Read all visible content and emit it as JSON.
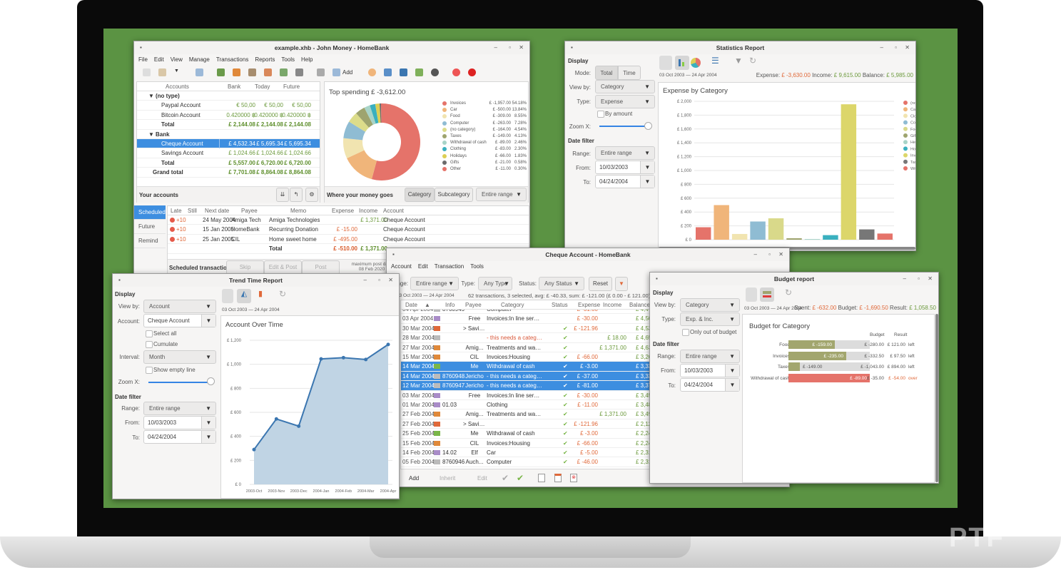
{
  "colors": {
    "accent": "#3d8ee0",
    "desktop": "#5b9343",
    "income": "#6c9a3d",
    "expense": "#e0693a"
  },
  "main": {
    "title": "example.xhb - John Money - HomeBank",
    "menu": [
      "File",
      "Edit",
      "View",
      "Manage",
      "Transactions",
      "Reports",
      "Tools",
      "Help"
    ],
    "toolbar": {
      "icons": [
        "new-file-icon",
        "open-file-icon",
        "dropdown-icon",
        "save-icon",
        "accounts-icon",
        "payees-icon",
        "categories-icon",
        "budget-icon",
        "archive-icon",
        "assistant-icon",
        "show-account-icon",
        "add-transaction-icon",
        "statistics-icon",
        "trend-icon",
        "balance-icon",
        "budget-report-icon",
        "vehicle-cost-icon",
        "help-icon",
        "donate-icon"
      ],
      "add_label": "Add"
    },
    "accounts": {
      "headers": [
        "Accounts",
        "Bank",
        "Today",
        "Future"
      ],
      "rows": [
        {
          "kind": "group",
          "name": "(no type)"
        },
        {
          "kind": "item",
          "name": "Paypal Account",
          "bank": "€ 50,00",
          "today": "€ 50,00",
          "future": "€ 50,00"
        },
        {
          "kind": "item",
          "name": "Bitcoin Account",
          "bank": "0.420000 ฿",
          "today": "0.420000 ฿",
          "future": "0.420000 ฿"
        },
        {
          "kind": "total",
          "name": "Total",
          "bank": "£ 2,144.08",
          "today": "£ 2,144.08",
          "future": "£ 2,144.08"
        },
        {
          "kind": "group",
          "name": "Bank"
        },
        {
          "kind": "selected",
          "name": "Cheque Account",
          "bank": "£ 4,532.34",
          "today": "£ 5,695.34",
          "future": "£ 5,695.34"
        },
        {
          "kind": "item",
          "name": "Savings Account",
          "bank": "£ 1,024.66",
          "today": "£ 1,024.66",
          "future": "£ 1,024.66"
        },
        {
          "kind": "total",
          "name": "Total",
          "bank": "£ 5,557.00",
          "today": "£ 6,720.00",
          "future": "£ 6,720.00"
        },
        {
          "kind": "grand",
          "name": "Grand total",
          "bank": "£ 7,701.08",
          "today": "£ 8,864.08",
          "future": "£ 8,864.08"
        }
      ],
      "footer": "Your accounts"
    },
    "spending": {
      "title": "Top spending £ -3,612.00",
      "footer": "Where your money goes",
      "buttons": [
        "Category",
        "Subcategory"
      ],
      "range": "Entire range"
    },
    "scheduled": {
      "tabs": [
        "Scheduled",
        "Future",
        "Remind"
      ],
      "headers": [
        "Late",
        "Still",
        "Next date",
        "Payee",
        "Memo",
        "Expense",
        "Income",
        "Account"
      ],
      "rows": [
        {
          "late": "+10",
          "date": "24 May 2004",
          "payee": "Amiga Tech",
          "memo": "Amiga Technologies",
          "expense": "",
          "income": "£ 1,371.00",
          "account": "Cheque Account"
        },
        {
          "late": "+10",
          "date": "15 Jan 2005",
          "payee": "HomeBank",
          "memo": "Recurring Donation",
          "expense": "£ -15.00",
          "income": "",
          "account": "Cheque Account"
        },
        {
          "late": "+10",
          "date": "25 Jan 2005",
          "payee": "CIL",
          "memo": "Home sweet home",
          "expense": "£ -495.00",
          "income": "",
          "account": "Cheque Account"
        }
      ],
      "total": {
        "label": "Total",
        "expense": "£ -510.00",
        "income": "£ 1,371.00"
      },
      "footer": "Scheduled transactions",
      "buttons": [
        "Skip",
        "Edit & Post",
        "Post"
      ],
      "max_post_label": "maximum post date",
      "max_post_date": "08 Feb 2020"
    }
  },
  "stats": {
    "title": "Statistics Report",
    "display": "Display",
    "mode_label": "Mode:",
    "modes": [
      "Total",
      "Time"
    ],
    "viewby_label": "View by:",
    "viewby": "Category",
    "type_label": "Type:",
    "type": "Expense",
    "by_amount": "By amount",
    "zoom_label": "Zoom X:",
    "zoom": 1.0,
    "datefilter": "Date filter",
    "range_label": "Range:",
    "range": "Entire range",
    "from_label": "From:",
    "from": "10/03/2003",
    "to_label": "To:",
    "to": "04/24/2004",
    "period": "03 Oct 2003 — 24 Apr 2004",
    "summary": {
      "expense_label": "Expense:",
      "expense": "£ -3,630.00",
      "income_label": "Income:",
      "income": "£ 9,615.00",
      "balance_label": "Balance:",
      "balance": "£ 5,985.00"
    }
  },
  "trend": {
    "title": "Trend Time Report",
    "display": "Display",
    "viewby_label": "View by:",
    "viewby": "Account",
    "account_label": "Account:",
    "account": "Cheque Account",
    "select_all": "Select all",
    "cumulate": "Cumulate",
    "interval_label": "Interval:",
    "interval": "Month",
    "show_empty": "Show empty line",
    "zoom_label": "Zoom X:",
    "zoom": 1.0,
    "datefilter": "Date filter",
    "range_label": "Range:",
    "range": "Entire range",
    "from_label": "From:",
    "from": "10/03/2003",
    "to_label": "To:",
    "to": "04/24/2004",
    "period": "03 Oct 2003 — 24 Apr 2004"
  },
  "cheque": {
    "title": "Cheque Account - HomeBank",
    "menu": [
      "Account",
      "Edit",
      "Transaction",
      "Tools"
    ],
    "range_label": "Range:",
    "range": "Entire range",
    "type_label": "Type:",
    "type": "Any Type",
    "status_label": "Status:",
    "status": "Any Status",
    "reset": "Reset",
    "period": "03 Oct 2003 — 24 Apr 2004",
    "summary": "62 transactions, 3 selected, avg: £ -40.33, sum: £ -121.00 (£ 0.00 - £ 121.00)",
    "headers": [
      "Date",
      "Info",
      "Payee",
      "Category",
      "Status",
      "Expense",
      "Income",
      "Balance"
    ],
    "rows": [
      {
        "date": "04 Apr 2004",
        "info": "8760949",
        "payee": "",
        "category": "Computer",
        "status": "",
        "expense": "£ -31.00",
        "income": "",
        "balance": "£ 4,471.3",
        "icon": "cheque"
      },
      {
        "date": "03 Apr 2004",
        "info": "",
        "payee": "Free",
        "category": "Invoices:In line service/...",
        "status": "",
        "expense": "£ -30.00",
        "income": "",
        "balance": "£ 4,502.3",
        "icon": "card"
      },
      {
        "date": "30 Mar 2004",
        "info": "",
        "payee": "> Savin...",
        "category": "",
        "status": "✔",
        "expense": "£ -121.96",
        "income": "",
        "balance": "£ 4,532.3",
        "icon": "transfer"
      },
      {
        "date": "28 Mar 2004",
        "info": "",
        "payee": "",
        "category": "- this needs a category -",
        "status": "✔",
        "expense": "",
        "income": "£ 18.00",
        "balance": "£ 4,654.3",
        "icon": "cheque",
        "warn": true
      },
      {
        "date": "27 Mar 2004",
        "info": "",
        "payee": "Amig...",
        "category": "Treatments and wages...",
        "status": "✔",
        "expense": "",
        "income": "£ 1,371.00",
        "balance": "£ 4,636.3",
        "icon": "xfer"
      },
      {
        "date": "15 Mar 2004",
        "info": "",
        "payee": "CIL",
        "category": "Invoices:Housing",
        "status": "✔",
        "expense": "£ -66.00",
        "income": "",
        "balance": "£ 3,265.3",
        "icon": "xfer"
      },
      {
        "date": "14 Mar 2004",
        "info": "",
        "payee": "Me",
        "category": "Withdrawal of cash",
        "status": "✔",
        "expense": "£ -3.00",
        "income": "",
        "balance": "£ 3,331.3",
        "icon": "cash",
        "selected": true
      },
      {
        "date": "14 Mar 2004",
        "info": "8760948",
        "payee": "Jericho",
        "category": "- this needs a category -",
        "status": "✔",
        "expense": "£ -37.00",
        "income": "",
        "balance": "£ 3,334.3",
        "icon": "cheque",
        "selected": true
      },
      {
        "date": "12 Mar 2004",
        "info": "8760947",
        "payee": "Jericho",
        "category": "- this needs a category -",
        "status": "✔",
        "expense": "£ -81.00",
        "income": "",
        "balance": "£ 3,371.3",
        "icon": "cheque",
        "selected": true
      },
      {
        "date": "03 Mar 2004",
        "info": "",
        "payee": "Free",
        "category": "Invoices:In line service/...",
        "status": "✔",
        "expense": "£ -30.00",
        "income": "",
        "balance": "£ 3,452.3",
        "icon": "card"
      },
      {
        "date": "01 Mar 2004",
        "info": "01.03",
        "payee": "",
        "category": "Clothing",
        "status": "✔",
        "expense": "£ -11.00",
        "income": "",
        "balance": "£ 3,482.3",
        "icon": "card"
      },
      {
        "date": "27 Feb 2004",
        "info": "",
        "payee": "Amig...",
        "category": "Treatments and wages...",
        "status": "✔",
        "expense": "",
        "income": "£ 1,371.00",
        "balance": "£ 3,493.3",
        "icon": "xfer"
      },
      {
        "date": "27 Feb 2004",
        "info": "",
        "payee": "> Savin...",
        "category": "",
        "status": "✔",
        "expense": "£ -121.96",
        "income": "",
        "balance": "£ 2,122.3",
        "icon": "transfer"
      },
      {
        "date": "25 Feb 2004",
        "info": "",
        "payee": "Me",
        "category": "Withdrawal of cash",
        "status": "✔",
        "expense": "£ -3.00",
        "income": "",
        "balance": "£ 2,244.2",
        "icon": "cash"
      },
      {
        "date": "15 Feb 2004",
        "info": "",
        "payee": "CIL",
        "category": "Invoices:Housing",
        "status": "✔",
        "expense": "£ -66.00",
        "income": "",
        "balance": "£ 2,247.2",
        "icon": "xfer"
      },
      {
        "date": "14 Feb 2004",
        "info": "14.02",
        "payee": "Elf",
        "category": "Car",
        "status": "✔",
        "expense": "£ -5.00",
        "income": "",
        "balance": "£ 2,313.2",
        "icon": "card"
      },
      {
        "date": "05 Feb 2004",
        "info": "8760946",
        "payee": "Auch...",
        "category": "Computer",
        "status": "✔",
        "expense": "£ -46.00",
        "income": "",
        "balance": "£ 2,318.2",
        "icon": "cheque"
      }
    ],
    "bottom": {
      "add": "Add",
      "inherit": "Inherit",
      "edit": "Edit"
    }
  },
  "budget": {
    "title": "Budget report",
    "display": "Display",
    "viewby_label": "View by:",
    "viewby": "Category",
    "type_label": "Type:",
    "type": "Exp. & Inc.",
    "only_out": "Only out of budget",
    "datefilter": "Date filter",
    "range_label": "Range:",
    "range": "Entire range",
    "from_label": "From:",
    "from": "10/03/2003",
    "to_label": "To:",
    "to": "04/24/2004",
    "period": "03 Oct 2003 — 24 Apr 2004",
    "summary": {
      "spent_label": "Spent:",
      "spent": "£ -632.00",
      "budget_label": "Budget:",
      "budget": "£ -1,690.50",
      "result_label": "Result:",
      "result": "£ 1,058.50"
    },
    "chart_title": "Budget for Category",
    "col_budget": "Budget",
    "col_result": "Result",
    "rows": [
      {
        "name": "Food",
        "spent": "£ -159.00",
        "fill": 0.57,
        "budget": "£ -280.00",
        "result": "£ 121.00",
        "state": "left",
        "over": false
      },
      {
        "name": "Invoices",
        "spent": "£ -235.00",
        "fill": 0.71,
        "budget": "£ -332.50",
        "result": "£ 97.50",
        "state": "left",
        "over": false
      },
      {
        "name": "Taxes",
        "spent": "£ -149.00",
        "fill": 0.14,
        "budget": "£ -1,043.00",
        "result": "£ 894.00",
        "state": "left",
        "over": false
      },
      {
        "name": "Withdrawal of cash",
        "spent": "£ -89.00",
        "fill": 1.0,
        "budget": "£ -35.00",
        "result": "£ -54.00",
        "state": "over",
        "over": true
      }
    ]
  },
  "chart_data": [
    {
      "type": "pie",
      "title": "Top spending £ -3,612.00",
      "donut": true,
      "slices": [
        {
          "name": "Invoices",
          "amount": "£ -1,957.00",
          "pct": "54.18%",
          "value": 1957,
          "color": "#e5736a"
        },
        {
          "name": "Car",
          "amount": "£ -500.00",
          "pct": "13.84%",
          "value": 500,
          "color": "#f0b57a"
        },
        {
          "name": "Food",
          "amount": "£ -309.00",
          "pct": "8.55%",
          "value": 309,
          "color": "#f1e4b0"
        },
        {
          "name": "Computer",
          "amount": "£ -263.00",
          "pct": "7.28%",
          "value": 263,
          "color": "#8fbcd3"
        },
        {
          "name": "(no category)",
          "amount": "£ -164.00",
          "pct": "4.54%",
          "value": 164,
          "color": "#dcdc8a"
        },
        {
          "name": "Taxes",
          "amount": "£ -149.00",
          "pct": "4.13%",
          "value": 149,
          "color": "#9ea46e"
        },
        {
          "name": "Withdrawal of cash",
          "amount": "£ -89.00",
          "pct": "2.46%",
          "value": 89,
          "color": "#a8d4c8"
        },
        {
          "name": "Clothing",
          "amount": "£ -83.00",
          "pct": "2.30%",
          "value": 83,
          "color": "#3ab0bf"
        },
        {
          "name": "Holidays",
          "amount": "£ -66.00",
          "pct": "1.83%",
          "value": 66,
          "color": "#dccf55"
        },
        {
          "name": "Gifts",
          "amount": "£ -21.00",
          "pct": "0.58%",
          "value": 21,
          "color": "#6b6b6b"
        },
        {
          "name": "Other",
          "amount": "£ -11.00",
          "pct": "0.30%",
          "value": 11,
          "color": "#e5736a"
        }
      ],
      "legend": "right"
    },
    {
      "type": "bar",
      "title": "Expense by Category",
      "ylim": [
        0,
        2000
      ],
      "yticks": [
        "£ 0",
        "£ 200",
        "£ 400",
        "£ 600",
        "£ 800",
        "£ 1,000",
        "£ 1,200",
        "£ 1,400",
        "£ 1,600",
        "£ 1,800",
        "£ 2,000"
      ],
      "categories": [
        "(no category)",
        "Car",
        "Clothing",
        "Computer",
        "Food",
        "Gifts",
        "Health",
        "Holidays",
        "Invoices",
        "Taxes",
        "Withdrawal of cash"
      ],
      "values": [
        180,
        500,
        83,
        263,
        309,
        21,
        10,
        66,
        1957,
        149,
        89
      ],
      "colors": [
        "#e5736a",
        "#f0b57a",
        "#f1e4b0",
        "#8fbcd3",
        "#d9d98a",
        "#9ea46e",
        "#a8d4c8",
        "#3ab0bf",
        "#dcd66a",
        "#777777",
        "#e5736a"
      ],
      "legend": "right",
      "grid": true
    },
    {
      "type": "area",
      "title": "Account Over Time",
      "ylim": [
        0,
        1200
      ],
      "yticks": [
        "£ 0",
        "£ 200",
        "£ 400",
        "£ 600",
        "£ 800",
        "£ 1,000",
        "£ 1,200"
      ],
      "categories": [
        "2003-Oct",
        "2003-Nov",
        "2003-Dec",
        "2004-Jan",
        "2004-Feb",
        "2004-Mar",
        "2004-Apr"
      ],
      "values": [
        290,
        545,
        485,
        1045,
        1055,
        1040,
        1165
      ],
      "color": "#3b76b0",
      "grid": true
    }
  ]
}
